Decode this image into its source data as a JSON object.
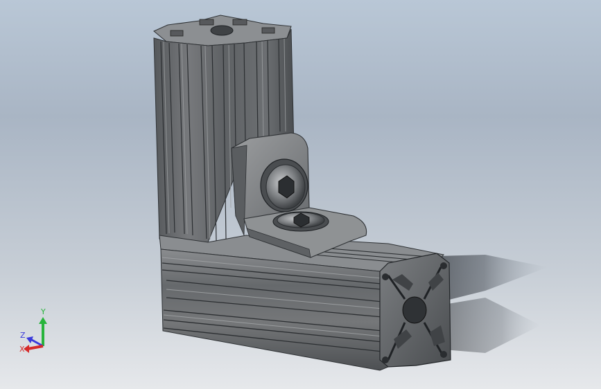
{
  "viewport": {
    "background_top": "#b9c7d6",
    "background_bottom": "#e6e8eb",
    "part_color": "#6f7275",
    "part_dark": "#3d4043",
    "part_light": "#a6a9ab"
  },
  "model": {
    "parts": [
      "vertical-extrusion",
      "horizontal-extrusion",
      "corner-bracket",
      "bracket-bolt-front",
      "bracket-bolt-bottom"
    ]
  },
  "triad": {
    "y_label": "Y",
    "z_label": "Z",
    "x_label": "X",
    "y_color": "#28b43c",
    "z_color": "#3a3adb",
    "x_color": "#d62a2a"
  }
}
